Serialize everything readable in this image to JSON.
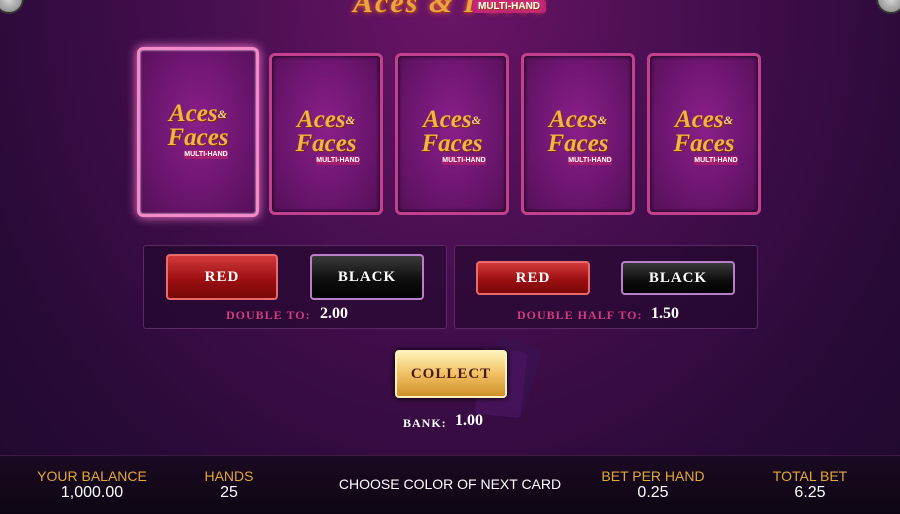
{
  "logo": {
    "text": "Aces & Faces",
    "subtitle": "MULTI-HAND"
  },
  "cards": [
    {
      "brand_top": "Aces",
      "brand_amp": "&",
      "brand_bottom": "Faces",
      "brand_sub": "MULTI-HAND",
      "held": true
    },
    {
      "brand_top": "Aces",
      "brand_amp": "&",
      "brand_bottom": "Faces",
      "brand_sub": "MULTI-HAND",
      "held": false
    },
    {
      "brand_top": "Aces",
      "brand_amp": "&",
      "brand_bottom": "Faces",
      "brand_sub": "MULTI-HAND",
      "held": false
    },
    {
      "brand_top": "Aces",
      "brand_amp": "&",
      "brand_bottom": "Faces",
      "brand_sub": "MULTI-HAND",
      "held": false
    },
    {
      "brand_top": "Aces",
      "brand_amp": "&",
      "brand_bottom": "Faces",
      "brand_sub": "MULTI-HAND",
      "held": false
    }
  ],
  "double_panel": {
    "red_label": "RED",
    "black_label": "BLACK",
    "label": "DOUBLE TO:",
    "value": "2.00"
  },
  "double_half_panel": {
    "red_label": "RED",
    "black_label": "BLACK",
    "label": "DOUBLE HALF TO:",
    "value": "1.50"
  },
  "collect": {
    "label": "COLLECT"
  },
  "bank": {
    "label": "BANK:",
    "value": "1.00"
  },
  "footer": {
    "balance_label": "YOUR BALANCE",
    "balance_value": "1,000.00",
    "hands_label": "HANDS",
    "hands_value": "25",
    "message": "CHOOSE COLOR OF NEXT CARD",
    "bet_per_hand_label": "BET PER HAND",
    "bet_per_hand_value": "0.25",
    "total_bet_label": "TOTAL BET",
    "total_bet_value": "6.25"
  },
  "colors": {
    "accent_gold": "#e2a83a",
    "label_pink": "#d13c80",
    "red_button": "#9c0f12",
    "black_button": "#0f0f0f"
  }
}
